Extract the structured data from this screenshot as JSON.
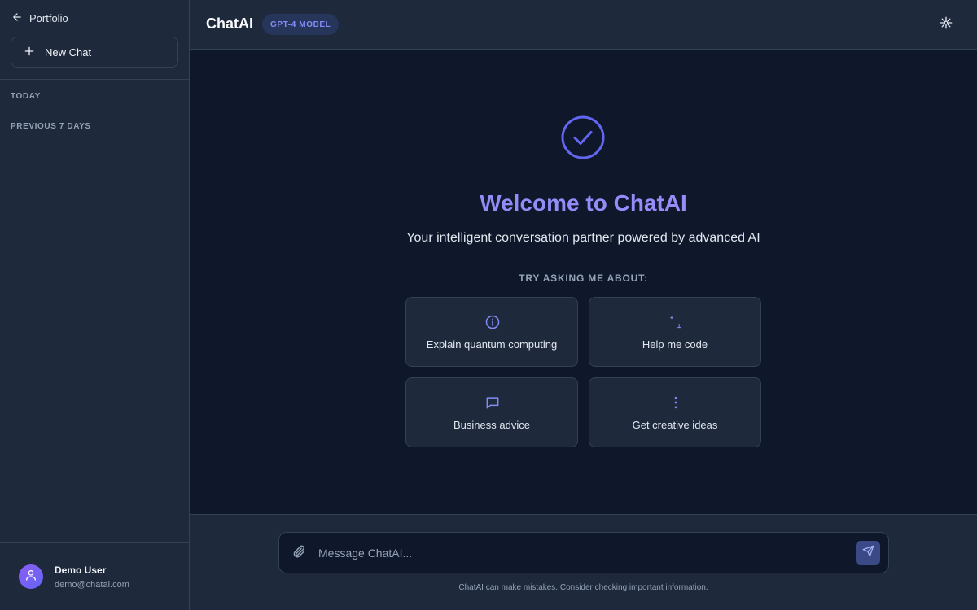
{
  "sidebar": {
    "back_label": "Portfolio",
    "new_chat_label": "New Chat",
    "sections": [
      "TODAY",
      "PREVIOUS 7 DAYS"
    ],
    "user": {
      "name": "Demo User",
      "email": "demo@chatai.com"
    }
  },
  "header": {
    "title": "ChatAI",
    "model_badge": "GPT-4 MODEL",
    "theme_icon": "sun-icon"
  },
  "welcome": {
    "icon": "check-circle-icon",
    "title": "Welcome to ChatAI",
    "subtitle": "Your intelligent conversation partner powered by advanced AI",
    "try_label": "TRY ASKING ME ABOUT:"
  },
  "suggestions": [
    {
      "label": "Explain quantum computing",
      "icon": "info-icon"
    },
    {
      "label": "Help me code",
      "icon": "sparkles-icon"
    },
    {
      "label": "Business advice",
      "icon": "chat-bubble-icon"
    },
    {
      "label": "Get creative ideas",
      "icon": "more-vertical-icon"
    }
  ],
  "composer": {
    "placeholder": "Message ChatAI...",
    "value": "",
    "disclaimer": "ChatAI can make mistakes. Consider checking important information."
  },
  "colors": {
    "accent": "#818cf8",
    "background": "#0f172a",
    "surface": "#1e293b",
    "border": "#334155"
  }
}
